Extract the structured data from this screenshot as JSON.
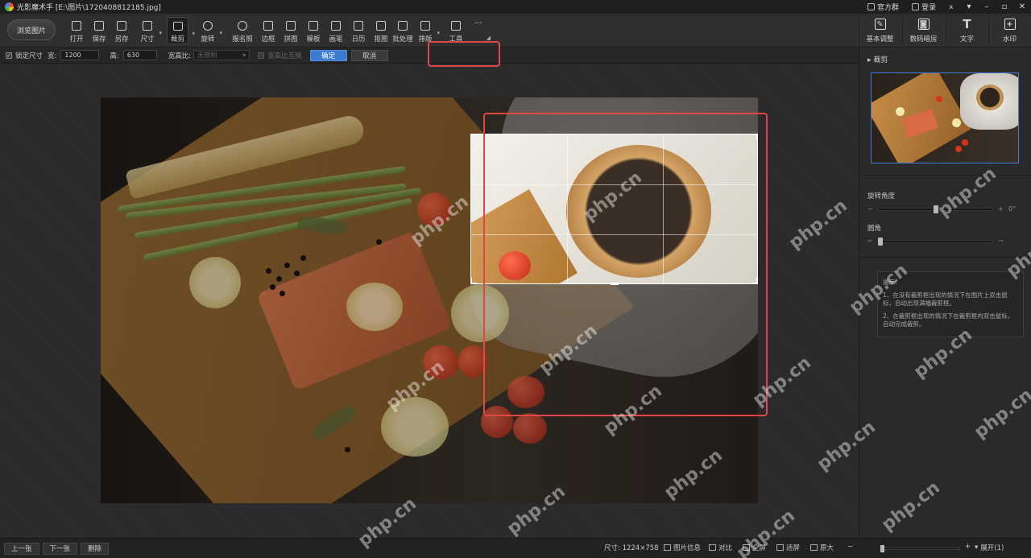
{
  "window": {
    "title": "光影魔术手 [E:\\图片\\1720408812185.jpg]",
    "links": [
      {
        "label": "官方群",
        "icon": "group-icon"
      },
      {
        "label": "登录",
        "icon": "user-icon"
      }
    ],
    "controls": [
      "pin-icon",
      "restore-icon",
      "minimize-icon",
      "close-icon"
    ]
  },
  "toolbar": {
    "browse_label": "浏览图片",
    "tools": [
      {
        "label": "打开",
        "icon": "open-icon"
      },
      {
        "label": "保存",
        "icon": "save-icon"
      },
      {
        "label": "另存",
        "icon": "save-as-icon"
      },
      {
        "label": "尺寸",
        "icon": "resize-icon"
      },
      {
        "label": "裁剪",
        "icon": "crop-icon"
      },
      {
        "label": "旋转",
        "icon": "rotate-icon"
      },
      {
        "label": "报名照",
        "icon": "id-photo-icon"
      },
      {
        "label": "边框",
        "icon": "border-icon"
      },
      {
        "label": "拼图",
        "icon": "collage-icon"
      },
      {
        "label": "模板",
        "icon": "template-icon"
      },
      {
        "label": "画笔",
        "icon": "brush-icon"
      },
      {
        "label": "日历",
        "icon": "calendar-icon"
      },
      {
        "label": "抠图",
        "icon": "cutout-icon"
      },
      {
        "label": "批处理",
        "icon": "batch-icon"
      },
      {
        "label": "排版",
        "icon": "layout-icon"
      },
      {
        "label": "工具",
        "icon": "wrench-icon"
      },
      {
        "label": "···",
        "icon": "more-icon"
      }
    ],
    "right_tools": [
      {
        "label": "基本调整",
        "icon": "adjust-icon",
        "glyph": "✎"
      },
      {
        "label": "数码暗房",
        "icon": "camera-icon",
        "glyph": "◙"
      },
      {
        "label": "文字",
        "icon": "text-icon",
        "glyph": "T"
      },
      {
        "label": "水印",
        "icon": "watermark-icon",
        "glyph": "+"
      }
    ]
  },
  "options": {
    "lock_size_label": "锁定尺寸",
    "lock_checked": "✓",
    "width_label": "宽:",
    "width_value": "1200",
    "height_label": "高:",
    "height_value": "630",
    "ratio_label": "宽高比:",
    "ratio_value": "无限制",
    "swap_label": "宽高比互换",
    "confirm": "确定",
    "cancel": "取消"
  },
  "panel": {
    "title": "裁剪",
    "rotation_label": "旋转角度",
    "rotation_value": "0°",
    "rotation_min": "−",
    "rotation_max": "+",
    "corner_label": "圆角",
    "tips_title": "提示:",
    "tips": [
      "1、在没有裁剪框出现的情况下在图片上双击鼠标，自动出现满幅裁剪框。",
      "2、在裁剪框出现的情况下在裁剪框内双击鼠标，自动完成裁剪。"
    ]
  },
  "status": {
    "prev": "上一张",
    "next": "下一张",
    "delete": "删除",
    "size_text": "尺寸: 1224×758",
    "items": [
      {
        "label": "图片信息",
        "icon": "info-icon"
      },
      {
        "label": "对比",
        "icon": "compare-icon"
      },
      {
        "label": "全屏",
        "icon": "fullscreen-icon"
      },
      {
        "label": "适屏",
        "icon": "fit-icon"
      },
      {
        "label": "原大",
        "icon": "actual-size-icon"
      }
    ],
    "zoom_minus": "−",
    "zoom_plus": "+",
    "expand": "展开(1)"
  },
  "watermark_text": "php.cn",
  "colors": {
    "accent": "#3b7bd1",
    "highlight": "#e04848"
  }
}
